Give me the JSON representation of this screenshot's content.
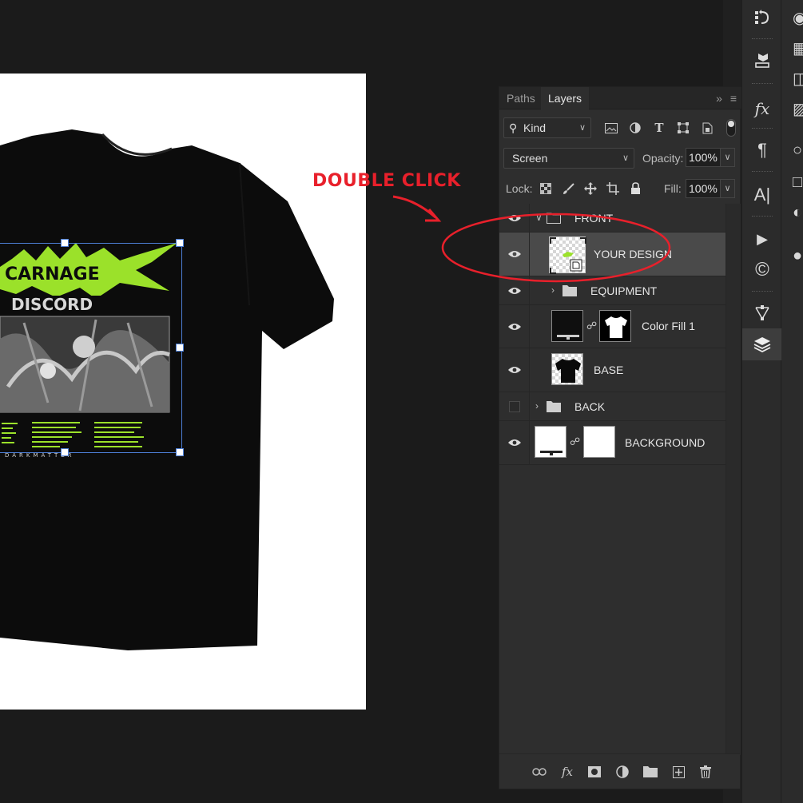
{
  "canvas": {
    "design_top_text": "CARNAGE",
    "design_sub_text": "DISCORD",
    "design_bottom_text": "DARKMATTER"
  },
  "panel": {
    "tabs": [
      {
        "label": "Paths",
        "active": false
      },
      {
        "label": "Layers",
        "active": true
      }
    ],
    "collapse_icon": "double-chevron-right-icon",
    "filter": {
      "kind_label": "Kind"
    },
    "blend_mode": "Screen",
    "opacity_label": "Opacity:",
    "opacity_value": "100%",
    "lock_label": "Lock:",
    "fill_label": "Fill:",
    "fill_value": "100%"
  },
  "layers": [
    {
      "name": "FRONT",
      "type": "group",
      "visible": true,
      "expanded": true
    },
    {
      "name": "YOUR DESIGN",
      "type": "smart-object",
      "visible": true,
      "selected": true
    },
    {
      "name": "EQUIPMENT",
      "type": "group",
      "visible": true,
      "expanded": false
    },
    {
      "name": "Color Fill 1",
      "type": "fill",
      "visible": true
    },
    {
      "name": "BASE",
      "type": "layer",
      "visible": true
    },
    {
      "name": "BACK",
      "type": "group",
      "visible": false,
      "expanded": false
    },
    {
      "name": "BACKGROUND",
      "type": "layer",
      "visible": true
    }
  ],
  "annotation": {
    "text": "DOUBLE CLICK",
    "color": "#e8202b"
  },
  "colors": {
    "design_accent": "#9be12a",
    "selection": "#4d7fd6"
  }
}
